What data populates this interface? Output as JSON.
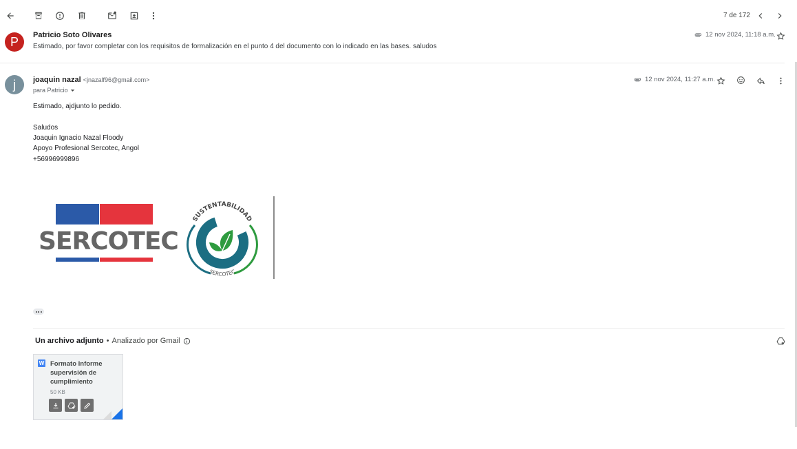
{
  "toolbar": {
    "icons": [
      "back-arrow-icon",
      "archive-icon",
      "report-spam-icon",
      "delete-icon",
      "mark-unread-icon",
      "move-to-icon",
      "more-vert-icon"
    ],
    "pager_text": "7 de 172"
  },
  "messages": [
    {
      "avatar_letter": "P",
      "avatar_color": "#c5221f",
      "sender": "Patricio Soto Olivares",
      "snippet": "Estimado, por favor completar con los requisitos de formalización en el punto 4 del documento con lo indicado en las bases. saludos",
      "date": "12 nov 2024, 11:18 a.m."
    },
    {
      "avatar_letter": "j",
      "avatar_color": "#78909c",
      "sender": "joaquin nazal",
      "sender_email": "<jnazalf96@gmail.com>",
      "recipient": "para Patricio",
      "date": "12 nov 2024, 11:27 a.m.",
      "body": {
        "greeting": "Estimado, ajdjunto lo pedido.",
        "sig_1": "Saludos",
        "sig_2": "Joaquin Ignacio Nazal Floody",
        "sig_3": "Apoyo Profesional Sercotec, Angol",
        "sig_4": "+56996999896"
      }
    }
  ],
  "logos": {
    "sercotec_text": "SERCOTEC",
    "sust_top": "SUSTENTABILIDAD",
    "sust_bottom": "SERCOTEC",
    "colors": {
      "blue": "#2b5aa8",
      "red": "#e5343d",
      "gray": "#666666",
      "teal": "#1c6e82",
      "green": "#2e9b3f"
    }
  },
  "attachments": {
    "title": "Un archivo adjunto",
    "separator": "•",
    "scan_label": "Analizado por Gmail",
    "file": {
      "type_letter": "W",
      "name": "Formato Informe supervisión de cumplimiento",
      "size": "50 KB"
    }
  }
}
